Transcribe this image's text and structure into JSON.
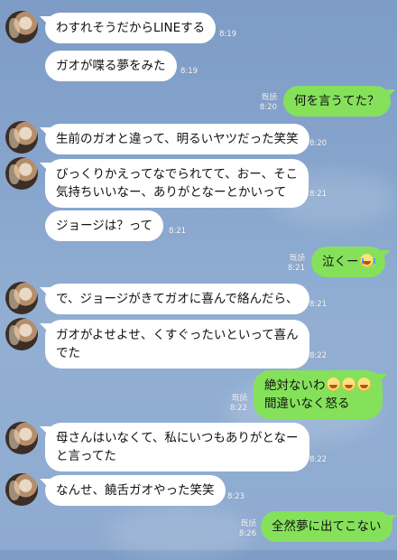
{
  "theme": {
    "incoming_bubble": "#ffffff",
    "outgoing_bubble": "#85e15a",
    "background": "#86a4cc",
    "meta_text": "#ffffff"
  },
  "messages": [
    {
      "direction": "in",
      "text": "わすれそうだからLINEする",
      "time": "8:19",
      "avatar": true
    },
    {
      "direction": "in",
      "text": "ガオが喋る夢をみた",
      "time": "8:19",
      "avatar": false
    },
    {
      "direction": "out",
      "text": "何を言うてた？",
      "read": "既読",
      "time": "8:20"
    },
    {
      "direction": "in",
      "text": "生前のガオと違って、明るいヤツだった笑笑",
      "time": "8:20",
      "avatar": true
    },
    {
      "direction": "in",
      "lines": [
        "びっくりかえってなでられてて、おー、そこ",
        "気持ちいいなー、ありがとなーとかいって"
      ],
      "time": "8:21",
      "avatar": true
    },
    {
      "direction": "in",
      "text": "ジョージは？って",
      "time": "8:21",
      "avatar": false
    },
    {
      "direction": "out",
      "text": "泣くー",
      "emoji": "crying-face-emoji",
      "read": "既読",
      "time": "8:21"
    },
    {
      "direction": "in",
      "text": "で、ジョージがきてガオに喜んで絡んだら、",
      "time": "8:21",
      "avatar": true
    },
    {
      "direction": "in",
      "lines": [
        "ガオがよせよせ、くすぐったいといって喜ん",
        "でた"
      ],
      "time": "8:22",
      "avatar": true
    },
    {
      "direction": "out",
      "lines": [
        "絶対ないわ",
        "間違いなく怒る"
      ],
      "emoji": "grinning-sweat-emoji",
      "read": "既読",
      "time": "8:22"
    },
    {
      "direction": "in",
      "lines": [
        "母さんはいなくて、私にいつもありがとなー",
        "と言ってた"
      ],
      "time": "8:22",
      "avatar": true
    },
    {
      "direction": "in",
      "text": "なんせ、饒舌ガオやった笑笑",
      "time": "8:23",
      "avatar": true
    },
    {
      "direction": "out",
      "text": "全然夢に出てこない",
      "read": "既読",
      "time": "8:26"
    }
  ]
}
